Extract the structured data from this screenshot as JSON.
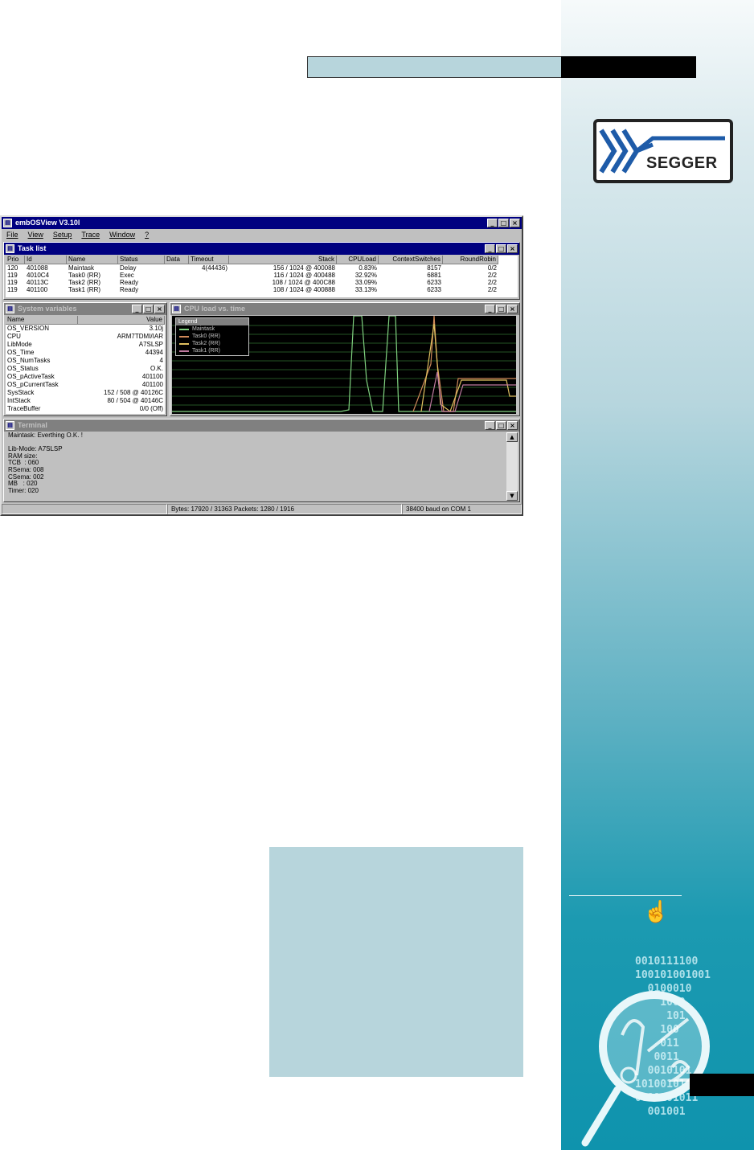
{
  "brand": {
    "logo_word": "SEGGER"
  },
  "side": {
    "binary_lines": [
      "0010111100",
      "100101001001",
      "  0100010",
      "    1000",
      "     101",
      "    100",
      "    011",
      "   0011",
      "  0010101",
      "1010010101",
      "0011101011",
      "  001001"
    ]
  },
  "app": {
    "title": "embOSView V3.10l",
    "menu": [
      "File",
      "View",
      "Setup",
      "Trace",
      "Window",
      "?"
    ],
    "tasklist": {
      "title": "Task list",
      "columns": [
        "Prio",
        "Id",
        "Name",
        "Status",
        "Data",
        "Timeout",
        "Stack",
        "CPULoad",
        "ContextSwitches",
        "RoundRobin"
      ],
      "rows": [
        [
          "120",
          "401088",
          "Maintask",
          "Delay",
          "",
          "4(44436)",
          "156 / 1024 @ 400088",
          "0.83%",
          "8157",
          "0/2"
        ],
        [
          "119",
          "4010C4",
          "Task0 (RR)",
          "Exec",
          "",
          "",
          "116 / 1024 @ 400488",
          "32.92%",
          "6881",
          "2/2"
        ],
        [
          "119",
          "40113C",
          "Task2 (RR)",
          "Ready",
          "",
          "",
          "108 / 1024 @ 400C88",
          "33.09%",
          "6233",
          "2/2"
        ],
        [
          "119",
          "401100",
          "Task1 (RR)",
          "Ready",
          "",
          "",
          "108 / 1024 @ 400888",
          "33.13%",
          "6233",
          "2/2"
        ]
      ]
    },
    "sysvars": {
      "title": "System variables",
      "columns": [
        "Name",
        "Value"
      ],
      "rows": [
        [
          "OS_VERSION",
          "3.10j"
        ],
        [
          "CPU",
          "ARM7TDMI/IAR"
        ],
        [
          "LibMode",
          "A7SLSP"
        ],
        [
          "OS_Time",
          "44394"
        ],
        [
          "OS_NumTasks",
          "4"
        ],
        [
          "OS_Status",
          "O.K."
        ],
        [
          "OS_pActiveTask",
          "401100"
        ],
        [
          "OS_pCurrentTask",
          "401100"
        ],
        [
          "SysStack",
          "152 / 508 @ 40126C"
        ],
        [
          "IntStack",
          "80 / 504 @ 40146C"
        ],
        [
          "TraceBuffer",
          "0/0 (Off)"
        ]
      ]
    },
    "cpuload": {
      "title": "CPU load vs. time",
      "legend_title": "Legend",
      "legend": [
        {
          "name": "Maintask",
          "color": "#7fd07f"
        },
        {
          "name": "Task0 (RR)",
          "color": "#d08a5a"
        },
        {
          "name": "Task2 (RR)",
          "color": "#e0c060"
        },
        {
          "name": "Task1 (RR)",
          "color": "#c07aa0"
        }
      ]
    },
    "terminal": {
      "title": "Terminal",
      "lines": [
        "Maintask: Everthing O.K. !",
        "",
        "Lib-Mode: A7SLSP",
        "RAM size:",
        "TCB  : 060",
        "RSema: 008",
        "CSema: 002",
        "MB   : 020",
        "Timer: 020"
      ]
    },
    "status": {
      "bytes": "Bytes: 17920 / 31363  Packets: 1280 / 1916",
      "baud": "38400 baud on COM 1"
    }
  }
}
